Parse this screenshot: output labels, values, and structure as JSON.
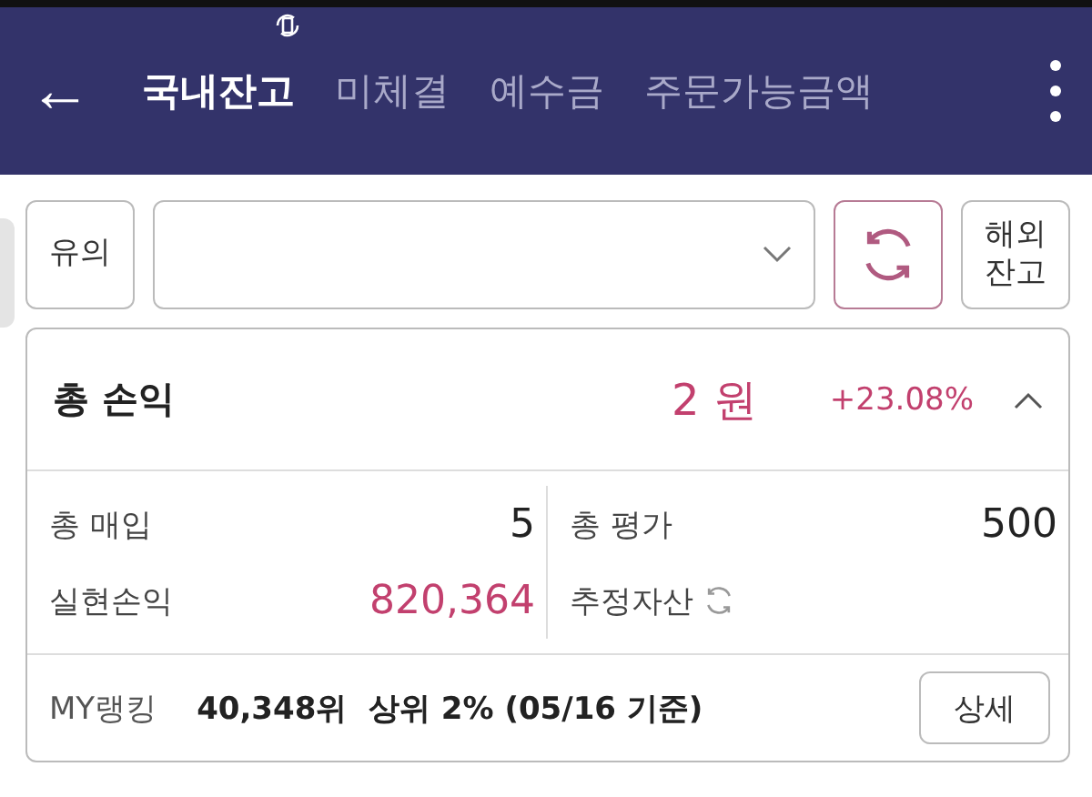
{
  "header": {
    "back": "←",
    "tabs": [
      {
        "label": "국내잔고",
        "selected": true
      },
      {
        "label": "미체결",
        "selected": false
      },
      {
        "label": "예수금",
        "selected": false
      },
      {
        "label": "주문가능금액",
        "selected": false
      }
    ]
  },
  "toolbar": {
    "notice_button": "유의",
    "overseas_button": "해외\n잔고"
  },
  "summary": {
    "title": "총 손익",
    "amount": "2 원",
    "rate": "+23.08%",
    "expanded": true,
    "stats": [
      {
        "label": "총 매입",
        "value": "5",
        "kind": "plain"
      },
      {
        "label": "총 평가",
        "value": "500",
        "kind": "plain"
      },
      {
        "label": "실현손익",
        "value": "820,364",
        "kind": "gain"
      },
      {
        "label": "추정자산",
        "kind": "refresh"
      }
    ],
    "ranking": {
      "label": "MY랭킹",
      "text": "40,348위  상위 2% (05/16 기준)",
      "button": "상세"
    }
  }
}
